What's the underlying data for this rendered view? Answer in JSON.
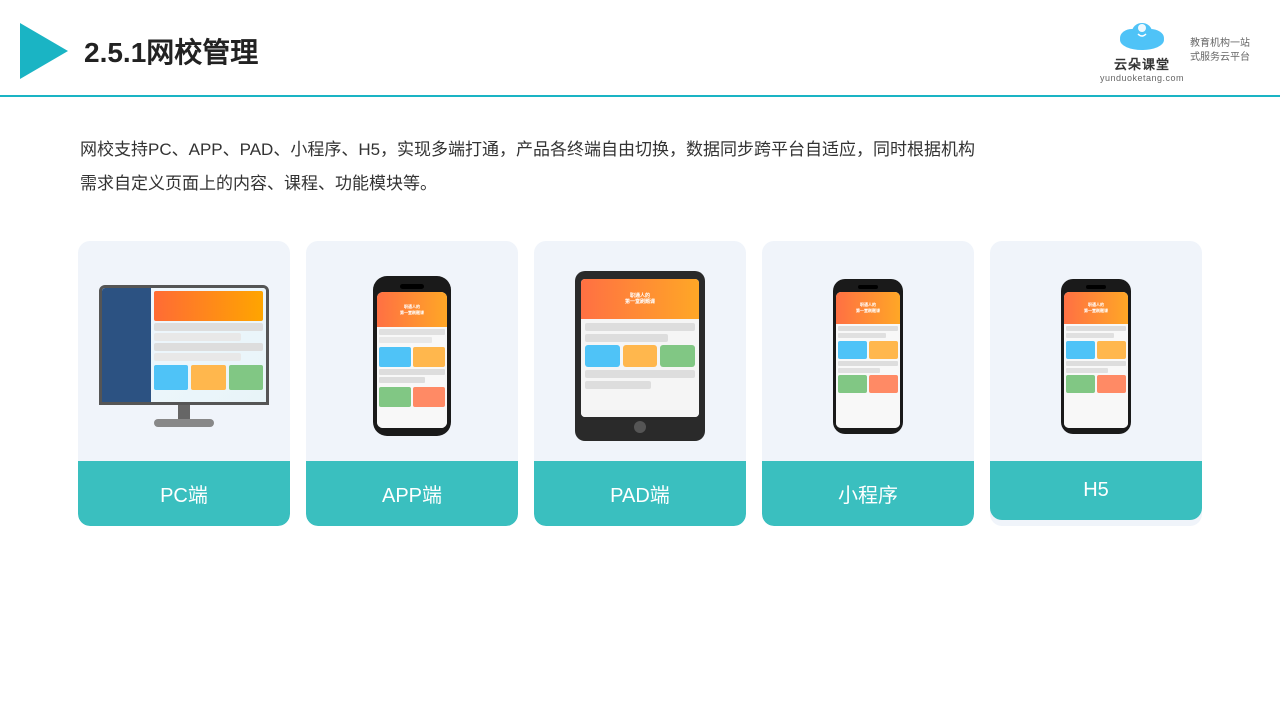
{
  "header": {
    "title": "2.5.1网校管理",
    "logo_main": "云朵课堂",
    "logo_sub": "yunduoketang.com",
    "logo_tag1": "教育机构一站",
    "logo_tag2": "式服务云平台"
  },
  "description": {
    "line1": "网校支持PC、APP、PAD、小程序、H5，实现多端打通，产品各终端自由切换，数据同步跨平台自适应，同时根据机构",
    "line2": "需求自定义页面上的内容、课程、功能模块等。"
  },
  "cards": [
    {
      "label": "PC端",
      "type": "pc"
    },
    {
      "label": "APP端",
      "type": "phone"
    },
    {
      "label": "PAD端",
      "type": "tablet"
    },
    {
      "label": "小程序",
      "type": "phone_mini"
    },
    {
      "label": "H5",
      "type": "phone_mini2"
    }
  ],
  "accent_color": "#3abfbf"
}
